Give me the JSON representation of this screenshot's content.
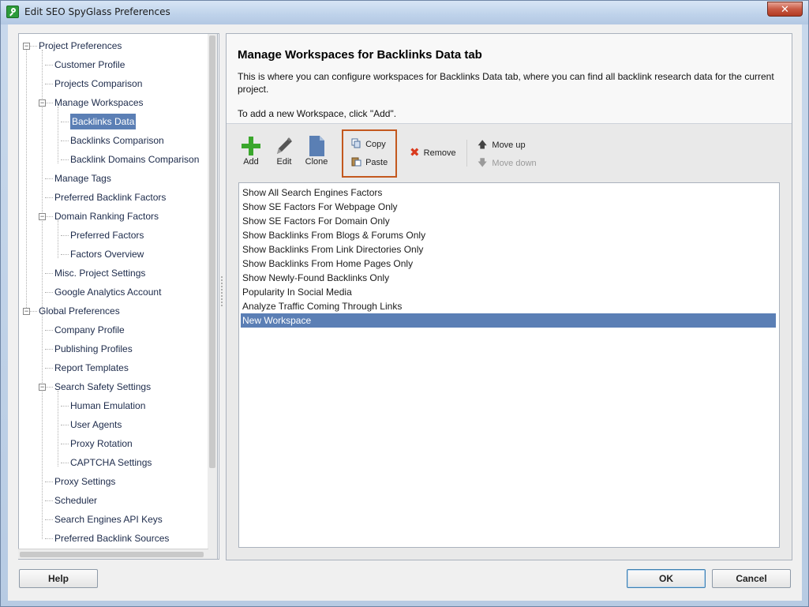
{
  "window": {
    "title": "Edit SEO SpyGlass Preferences",
    "close_glyph": "✕"
  },
  "tree": {
    "items": [
      {
        "label": "Project Preferences",
        "level": 0,
        "toggle": "−"
      },
      {
        "label": "Customer Profile",
        "level": 1
      },
      {
        "label": "Projects Comparison",
        "level": 1
      },
      {
        "label": "Manage Workspaces",
        "level": 1,
        "toggle": "−"
      },
      {
        "label": "Backlinks Data",
        "level": 2,
        "selected": true
      },
      {
        "label": "Backlinks Comparison",
        "level": 2
      },
      {
        "label": "Backlink Domains Comparison",
        "level": 2
      },
      {
        "label": "Manage Tags",
        "level": 1
      },
      {
        "label": "Preferred Backlink Factors",
        "level": 1
      },
      {
        "label": "Domain Ranking Factors",
        "level": 1,
        "toggle": "−"
      },
      {
        "label": "Preferred Factors",
        "level": 2
      },
      {
        "label": "Factors Overview",
        "level": 2
      },
      {
        "label": "Misc. Project Settings",
        "level": 1
      },
      {
        "label": "Google Analytics Account",
        "level": 1
      },
      {
        "label": "Global Preferences",
        "level": 0,
        "toggle": "−"
      },
      {
        "label": "Company Profile",
        "level": 1
      },
      {
        "label": "Publishing Profiles",
        "level": 1
      },
      {
        "label": "Report Templates",
        "level": 1
      },
      {
        "label": "Search Safety Settings",
        "level": 1,
        "toggle": "−"
      },
      {
        "label": "Human Emulation",
        "level": 2
      },
      {
        "label": "User Agents",
        "level": 2
      },
      {
        "label": "Proxy Rotation",
        "level": 2
      },
      {
        "label": "CAPTCHA Settings",
        "level": 2
      },
      {
        "label": "Proxy Settings",
        "level": 1
      },
      {
        "label": "Scheduler",
        "level": 1
      },
      {
        "label": "Search Engines API Keys",
        "level": 1
      },
      {
        "label": "Preferred Backlink Sources",
        "level": 1
      }
    ]
  },
  "main": {
    "title": "Manage Workspaces for Backlinks Data tab",
    "description": "This is where you can configure workspaces for Backlinks Data tab, where you can find all backlink research data for the current project.",
    "hint": "To add a new Workspace, click \"Add\"."
  },
  "toolbar": {
    "add_label": "Add",
    "edit_label": "Edit",
    "clone_label": "Clone",
    "copy_label": "Copy",
    "paste_label": "Paste",
    "remove_label": "Remove",
    "move_up_label": "Move up",
    "move_down_label": "Move down",
    "colors": {
      "add": "#3aa72c",
      "remove": "#d93a1e",
      "highlight": "#c3581e"
    }
  },
  "workspaces": [
    {
      "label": "Show All Search Engines Factors"
    },
    {
      "label": "Show SE Factors For Webpage Only"
    },
    {
      "label": "Show SE Factors For Domain Only"
    },
    {
      "label": "Show Backlinks From Blogs & Forums Only"
    },
    {
      "label": "Show Backlinks From Link Directories Only"
    },
    {
      "label": "Show Backlinks From Home Pages Only"
    },
    {
      "label": "Show Newly-Found Backlinks Only"
    },
    {
      "label": "Popularity In Social Media"
    },
    {
      "label": "Analyze Traffic Coming Through Links"
    },
    {
      "label": "New Workspace",
      "selected": true
    }
  ],
  "footer": {
    "help_label": "Help",
    "ok_label": "OK",
    "cancel_label": "Cancel"
  },
  "colors": {
    "selection": "#5b7fb5"
  }
}
